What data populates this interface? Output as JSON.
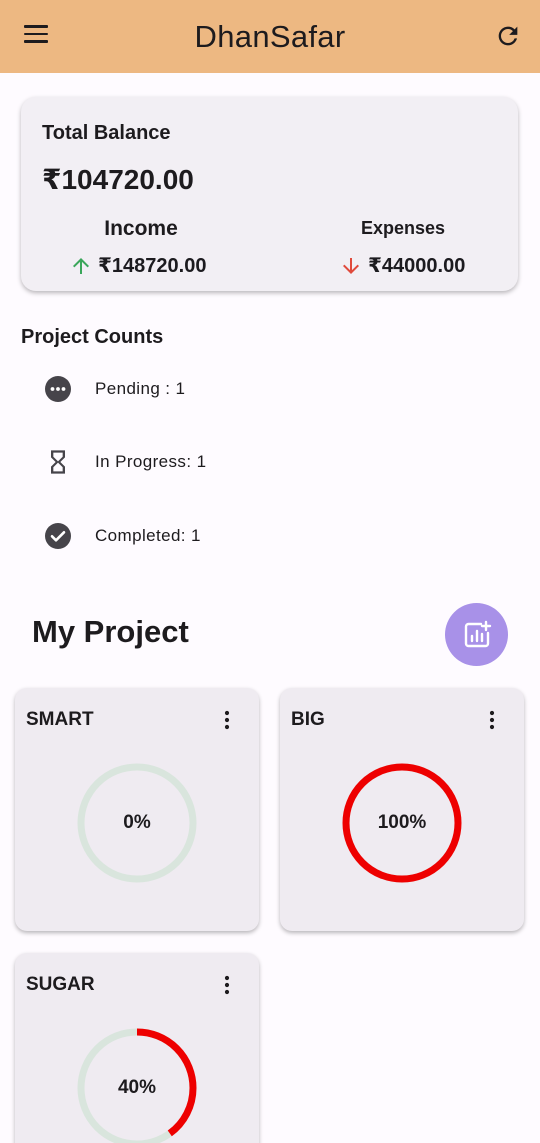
{
  "app": {
    "title": "DhanSafar"
  },
  "icons": {
    "menu": "menu-icon",
    "refresh": "refresh-icon",
    "add_chart": "add-chart-icon",
    "more": "more-vert-icon"
  },
  "balance": {
    "label": "Total Balance",
    "amount": "₹104720.00",
    "income_label": "Income",
    "income_amount": "₹148720.00",
    "expenses_label": "Expenses",
    "expenses_amount": "₹44000.00"
  },
  "project_counts": {
    "heading": "Project Counts",
    "items": [
      {
        "label": "Pending : 1",
        "icon": "more-horiz-circle-icon"
      },
      {
        "label": "In Progress: 1",
        "icon": "hourglass-icon"
      },
      {
        "label": "Completed: 1",
        "icon": "check-circle-icon"
      }
    ]
  },
  "my_project": {
    "heading": "My Project",
    "projects": [
      {
        "name": "SMART",
        "progress_label": "0%",
        "progress": 0
      },
      {
        "name": "BIG",
        "progress_label": "100%",
        "progress": 1.0
      },
      {
        "name": "SUGAR",
        "progress_label": "40%",
        "progress": 0.4
      }
    ]
  },
  "colors": {
    "app_bar": "#edb882",
    "income_arrow": "#3aa65a",
    "expense_arrow": "#e04a3c",
    "fab": "#a891e8",
    "progress": "#ee0000",
    "progress_track": "#d9e5dd"
  }
}
